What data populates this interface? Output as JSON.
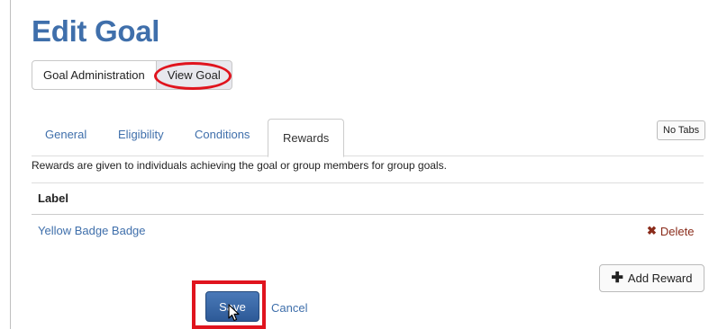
{
  "page": {
    "title": "Edit Goal"
  },
  "view_toggle": {
    "items": [
      {
        "label": "Goal Administration",
        "active": false
      },
      {
        "label": "View Goal",
        "active": true
      }
    ]
  },
  "tabs": [
    {
      "label": "General",
      "active": false
    },
    {
      "label": "Eligibility",
      "active": false
    },
    {
      "label": "Conditions",
      "active": false
    },
    {
      "label": "Rewards",
      "active": true
    }
  ],
  "no_tabs_label": "No Tabs",
  "rewards": {
    "description": "Rewards are given to individuals achieving the goal or group members for group goals.",
    "column_header": "Label",
    "rows": [
      {
        "label": "Yellow Badge Badge",
        "delete_label": "Delete"
      }
    ],
    "add_label": "Add Reward"
  },
  "actions": {
    "save_label": "Save",
    "cancel_label": "Cancel"
  },
  "icons": {
    "delete": "x-icon",
    "add": "plus-icon",
    "cursor": "mouse-pointer-icon"
  },
  "colors": {
    "link": "#3f6fab",
    "primary": "#2d5a97",
    "highlight": "#e0141e",
    "delete": "#8a2b1a"
  }
}
